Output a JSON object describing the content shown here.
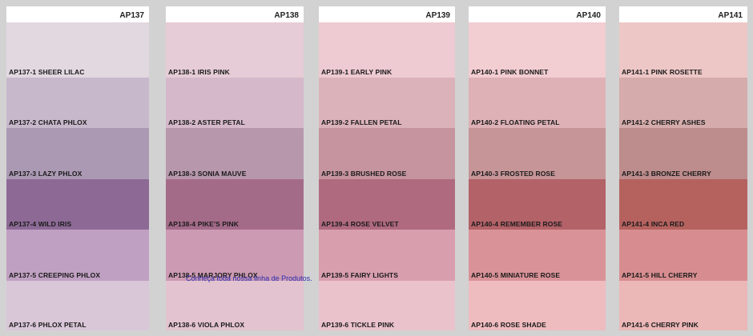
{
  "cards": [
    {
      "code": "AP137",
      "swatches": [
        {
          "label": "AP137-1  SHEER LILAC",
          "color": "#e2d8e0"
        },
        {
          "label": "AP137-2  CHATA PHLOX",
          "color": "#c8b8cc"
        },
        {
          "label": "AP137-3  LAZY PHLOX",
          "color": "#ab99b4"
        },
        {
          "label": "AP137-4  WILD IRIS",
          "color": "#8d6a96"
        },
        {
          "label": "AP137-5  CREEPING PHLOX",
          "color": "#c0a0c2"
        },
        {
          "label": "AP137-6  PHLOX PETAL",
          "color": "#d9c7d8"
        }
      ]
    },
    {
      "code": "AP138",
      "swatches": [
        {
          "label": "AP138-1  IRIS PINK",
          "color": "#e6ccd6"
        },
        {
          "label": "AP138-2  ASTER PETAL",
          "color": "#d5b8ca"
        },
        {
          "label": "AP138-3  SONIA MAUVE",
          "color": "#b797ac"
        },
        {
          "label": "AP138-4  PIKE'S PINK",
          "color": "#a46b89"
        },
        {
          "label": "AP138-5  MARJORY PHLOX",
          "color": "#cc9ab3"
        },
        {
          "label": "AP138-6  VIOLA PHLOX",
          "color": "#e2c3cf"
        }
      ]
    },
    {
      "code": "AP139",
      "swatches": [
        {
          "label": "AP139-1  EARLY PINK",
          "color": "#eecad2"
        },
        {
          "label": "AP139-2  FALLEN PETAL",
          "color": "#dcb2ba"
        },
        {
          "label": "AP139-3  BRUSHED ROSE",
          "color": "#c5949e"
        },
        {
          "label": "AP139-4  ROSE VELVET",
          "color": "#b06a80"
        },
        {
          "label": "AP139-5  FAIRY LIGHTS",
          "color": "#d89eae"
        },
        {
          "label": "AP139-6  TICKLE PINK",
          "color": "#e9c2cc"
        }
      ]
    },
    {
      "code": "AP140",
      "swatches": [
        {
          "label": "AP140-1  PINK BONNET",
          "color": "#f2cdd2"
        },
        {
          "label": "AP140-2  FLOATING PETAL",
          "color": "#deb1b6"
        },
        {
          "label": "AP140-3  FROSTED ROSE",
          "color": "#c69598"
        },
        {
          "label": "AP140-4  REMEMBER ROSE",
          "color": "#b36268"
        },
        {
          "label": "AP140-5  MINIATURE ROSE",
          "color": "#d99398"
        },
        {
          "label": "AP140-6  ROSE SHADE",
          "color": "#eebcbf"
        }
      ]
    },
    {
      "code": "AP141",
      "swatches": [
        {
          "label": "AP141-1  PINK ROSETTE",
          "color": "#edc7c6"
        },
        {
          "label": "AP141-2  CHERRY ASHES",
          "color": "#d5acab"
        },
        {
          "label": "AP141-3  BRONZE CHERRY",
          "color": "#bd8c8c"
        },
        {
          "label": "AP141-4  INCA RED",
          "color": "#b5625f"
        },
        {
          "label": "AP141-5  HILL CHERRY",
          "color": "#d78d8f"
        },
        {
          "label": "AP141-6  CHERRY PINK",
          "color": "#ebb7b7"
        }
      ]
    }
  ],
  "footer_note": "Conheça toda nossa linha de Produtos."
}
